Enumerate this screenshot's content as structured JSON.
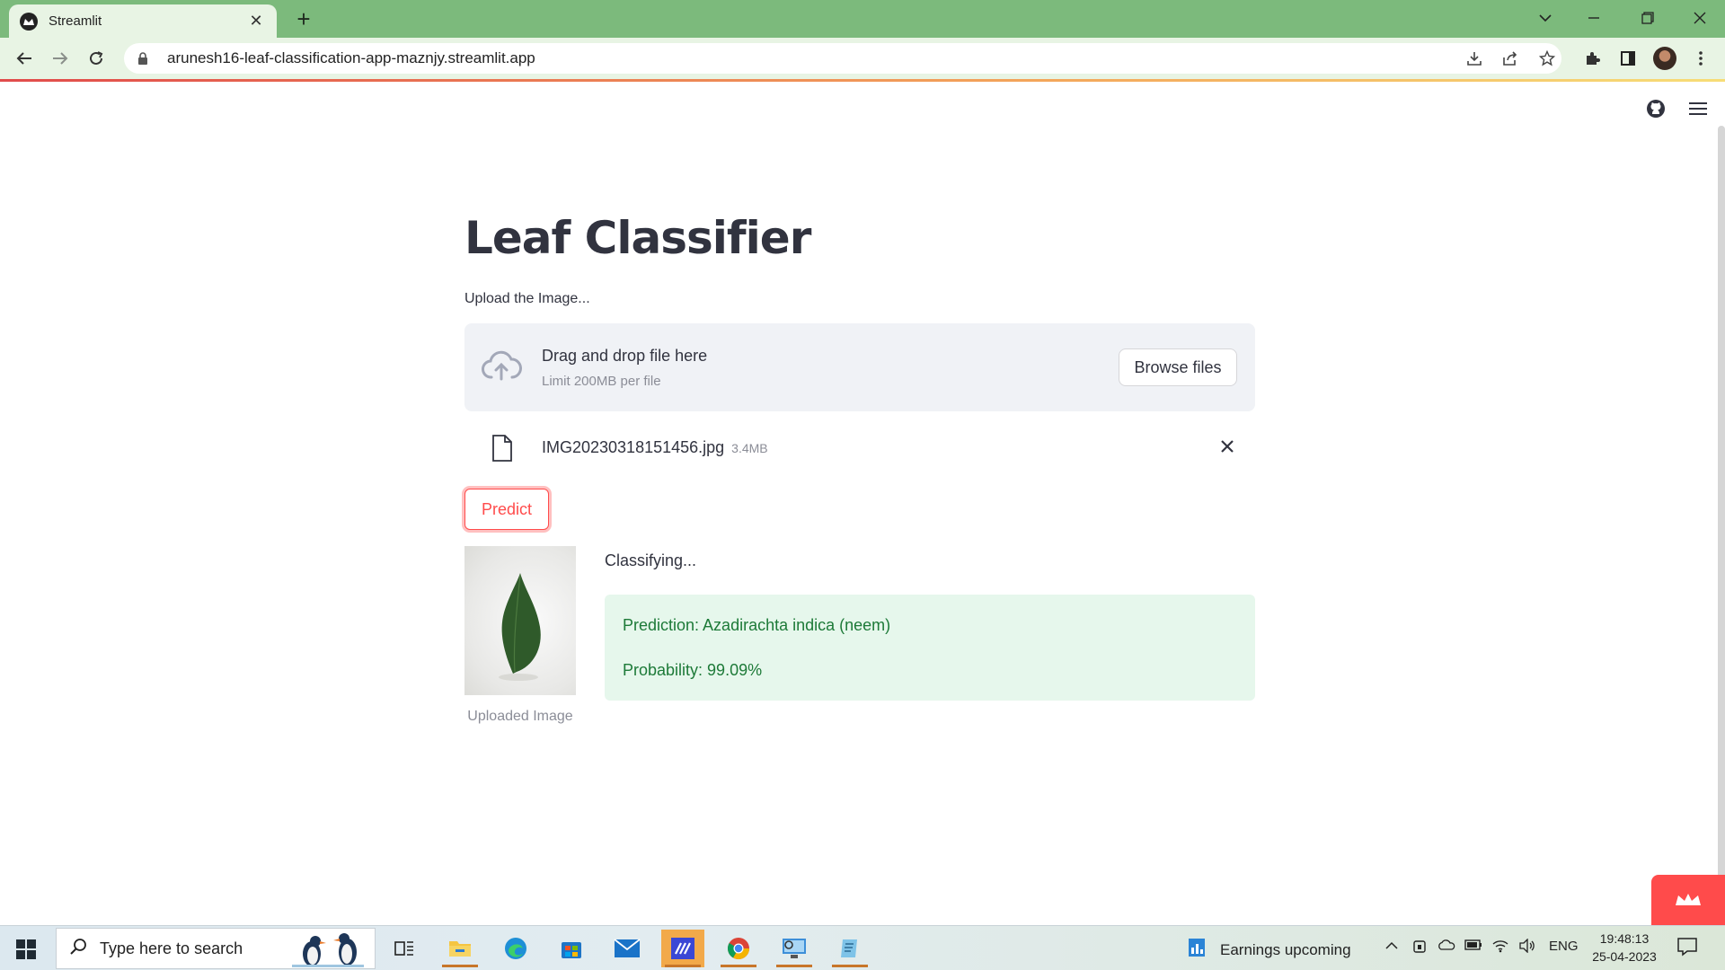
{
  "browser": {
    "tab_title": "Streamlit",
    "url": "arunesh16-leaf-classification-app-maznjy.streamlit.app"
  },
  "app": {
    "title": "Leaf Classifier",
    "upload_label": "Upload the Image...",
    "dropzone_main": "Drag and drop file here",
    "dropzone_sub": "Limit 200MB per file",
    "browse_label": "Browse files",
    "file_name": "IMG20230318151456.jpg",
    "file_size": "3.4MB",
    "predict_label": "Predict",
    "image_caption": "Uploaded Image",
    "status_text": "Classifying...",
    "prediction_text": "Prediction: Azadirachta indica (neem)",
    "probability_text": "Probability: 99.09%"
  },
  "taskbar": {
    "search_placeholder": "Type here to search",
    "weather_text": "Earnings upcoming",
    "language": "ENG",
    "time": "19:48:13",
    "date": "25-04-2023"
  },
  "colors": {
    "tab_strip": "#7cba7c",
    "primary": "#ff4b4b",
    "success_bg": "#e6f7ec",
    "success_text": "#1d7a38"
  },
  "icons": {
    "tab": [
      "streamlit-logo-icon",
      "close-icon",
      "plus-icon"
    ],
    "window": [
      "chevron-down-icon",
      "minimize-icon",
      "restore-icon",
      "close-icon"
    ],
    "nav": [
      "back-arrow-icon",
      "forward-arrow-icon",
      "reload-icon",
      "lock-icon"
    ],
    "toolbar": [
      "download-icon",
      "share-icon",
      "star-icon",
      "extension-icon",
      "side-panel-icon",
      "profile-avatar"
    ],
    "page": [
      "github-icon",
      "hamburger-menu-icon",
      "upload-cloud-icon",
      "file-icon",
      "close-icon",
      "streamlit-crown-icon"
    ],
    "taskbar": [
      "windows-start-icon",
      "search-icon",
      "task-view-icon",
      "file-explorer-icon",
      "edge-icon",
      "store-icon",
      "mail-icon",
      "visual-studio-icon",
      "chrome-icon",
      "remote-desktop-icon",
      "notepad-icon",
      "weather-icon",
      "chevron-up-icon",
      "meet-icon",
      "onedrive-icon",
      "battery-icon",
      "wifi-icon",
      "volume-icon",
      "notification-icon"
    ]
  }
}
